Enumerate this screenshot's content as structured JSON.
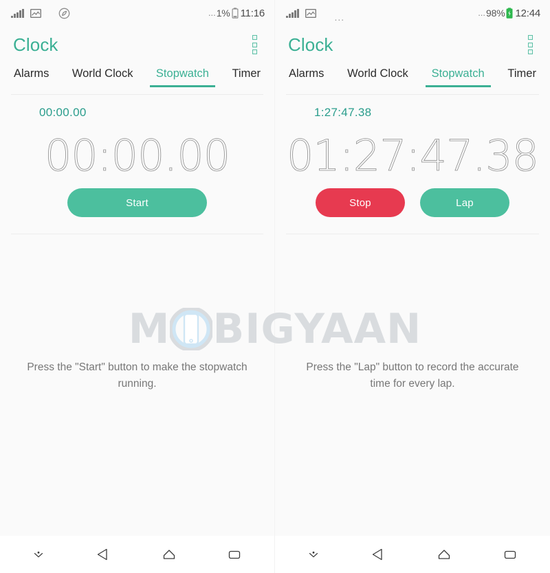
{
  "screens": [
    {
      "id": "left",
      "statusbar": {
        "icons": [
          "signal-bars-icon",
          "gallery-icon",
          "compass-icon"
        ],
        "battery_dots": "...",
        "battery_percent": "1%",
        "battery_icon": "battery-low-icon",
        "clock": "11:16"
      },
      "appbar": {
        "title": "Clock",
        "overflow_icon": "overflow-menu-icon"
      },
      "tabs": [
        {
          "label": "Alarms",
          "active": false
        },
        {
          "label": "World Clock",
          "active": false
        },
        {
          "label": "Stopwatch",
          "active": true
        },
        {
          "label": "Timer",
          "active": false
        }
      ],
      "stopwatch": {
        "small_time": "00:00.00",
        "big_time": "00:00.00",
        "buttons": [
          {
            "label": "Start",
            "style": "start"
          }
        ]
      },
      "hint": "Press the \"Start\" button to make the stopwatch running.",
      "navbar": [
        {
          "icon": "hide-navbar-icon",
          "name": "hide-navbar-button"
        },
        {
          "icon": "back-icon",
          "name": "back-button"
        },
        {
          "icon": "home-icon",
          "name": "home-button"
        },
        {
          "icon": "recents-icon",
          "name": "recents-button"
        }
      ]
    },
    {
      "id": "right",
      "statusbar": {
        "icons": [
          "signal-bars-icon",
          "gallery-icon",
          "more-dots-icon"
        ],
        "battery_dots": "...",
        "battery_percent": "98%",
        "battery_icon": "battery-full-icon",
        "clock": "12:44"
      },
      "appbar": {
        "title": "Clock",
        "overflow_icon": "overflow-menu-icon"
      },
      "tabs": [
        {
          "label": "Alarms",
          "active": false
        },
        {
          "label": "World Clock",
          "active": false
        },
        {
          "label": "Stopwatch",
          "active": true
        },
        {
          "label": "Timer",
          "active": false
        }
      ],
      "stopwatch": {
        "small_time": "1:27:47.38",
        "big_time": "01:27:47.38",
        "buttons": [
          {
            "label": "Stop",
            "style": "stop"
          },
          {
            "label": "Lap",
            "style": "lap"
          }
        ]
      },
      "hint": "Press the \"Lap\" button to record the accurate time for every lap.",
      "navbar": [
        {
          "icon": "hide-navbar-icon",
          "name": "hide-navbar-button"
        },
        {
          "icon": "back-icon",
          "name": "back-button"
        },
        {
          "icon": "home-icon",
          "name": "home-button"
        },
        {
          "icon": "recents-icon",
          "name": "recents-button"
        }
      ]
    }
  ],
  "watermark": {
    "text_before": "M",
    "text_after": "BIGYAAN",
    "full_text": "MOBIGYAAN",
    "icon": "phone-icon"
  },
  "colors": {
    "accent_teal": "#3bb094",
    "button_green": "#4cbf9e",
    "button_red": "#e73a50",
    "small_time_teal": "#2a9d8c",
    "big_digits_gray": "#8e8e8e",
    "hint_gray": "#777777",
    "background": "#fafafa",
    "watermark_gray": "#d9dcdf"
  }
}
